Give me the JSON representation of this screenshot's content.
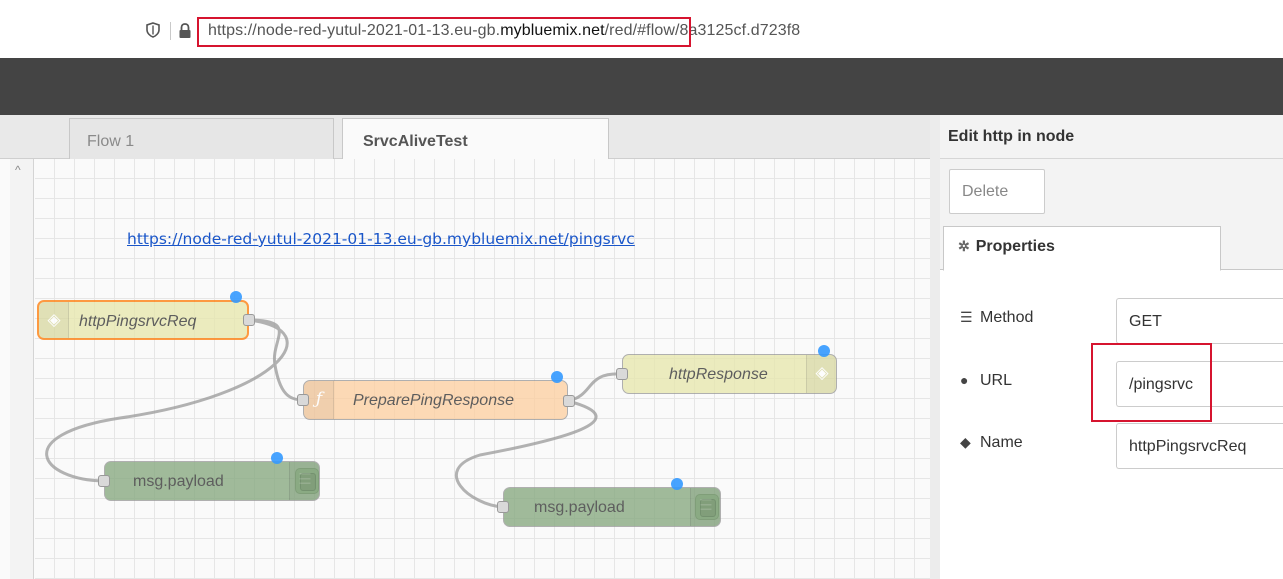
{
  "browser": {
    "url_host": "https://node-red-yutul-2021-01-13.eu-gb.",
    "url_bold": "mybluemix.net",
    "url_rest": "/red/#flow/8a3125cf.d723f8",
    "shield_icon": "shield-icon",
    "lock_icon": "lock-icon"
  },
  "workspace": {
    "tabs": [
      {
        "label": "Flow 1"
      },
      {
        "label": "SrvcAliveTest"
      }
    ],
    "annotation_link": "https://node-red-yutul-2021-01-13.eu-gb.mybluemix.net/pingsrvc",
    "nodes": {
      "http_in": {
        "label": "httpPingsrvcReq",
        "icon": "globe-icon",
        "color": "#e7e7ae"
      },
      "function": {
        "label": "PreparePingResponse",
        "icon": "function-icon",
        "color": "#fdd0a2"
      },
      "http_response": {
        "label": "httpResponse",
        "icon": "globe-icon",
        "color": "#e7e7ae"
      },
      "debug_1": {
        "label": "msg.payload",
        "icon": "list-icon",
        "color": "#87a980"
      },
      "debug_2": {
        "label": "msg.payload",
        "icon": "list-icon",
        "color": "#87a980"
      }
    },
    "accent_selected": "#ff7f0e",
    "changed_dot_color": "#3399ff"
  },
  "panel": {
    "title": "Edit http in node",
    "delete_label": "Delete",
    "properties_tab": "Properties",
    "fields": {
      "method": {
        "label": "Method",
        "value": "GET",
        "icon": "list-icon"
      },
      "url": {
        "label": "URL",
        "value": "/pingsrvc",
        "icon": "globe-icon"
      },
      "name": {
        "label": "Name",
        "value": "httpPingsrvcReq",
        "icon": "tag-icon"
      }
    },
    "highlight_color": "#d6142f"
  }
}
